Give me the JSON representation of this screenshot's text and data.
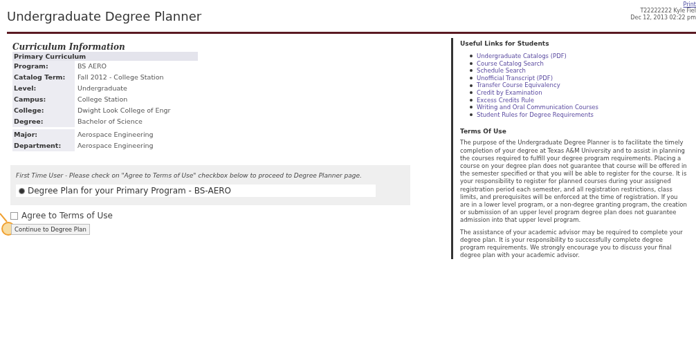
{
  "header": {
    "title": "Undergraduate Degree Planner",
    "print_link": "Print",
    "user": "T22222222 Kyle Fiel",
    "timestamp": "Dec 12, 2013 02:22 pm"
  },
  "curriculum": {
    "heading": "Curriculum Information",
    "subheading": "Primary Curriculum",
    "rows": [
      {
        "label": "Program:",
        "value": "BS AERO"
      },
      {
        "label": "Catalog Term:",
        "value": "Fall 2012 - College Station"
      },
      {
        "label": "Level:",
        "value": "Undergraduate"
      },
      {
        "label": "Campus:",
        "value": "College Station"
      },
      {
        "label": "College:",
        "value": "Dwight Look College of Engr"
      },
      {
        "label": "Degree:",
        "value": "Bachelor of Science"
      },
      {
        "label": "Major:",
        "value": "Aerospace Engineering"
      },
      {
        "label": "Department:",
        "value": "Aerospace Engineering"
      }
    ]
  },
  "notice": {
    "text": "First Time User - Please check on \"Agree to Terms of Use\" checkbox below to proceed to Degree Planner page.",
    "plan_option": {
      "label": "Degree Plan for your Primary Program - BS-AERO",
      "selected": true
    }
  },
  "agree": {
    "label": "Agree to Terms of Use",
    "checked": false
  },
  "continue_button": "Continue to Degree Plan",
  "links": {
    "heading": "Useful Links for Students",
    "items": [
      "Undergraduate Catalogs (PDF)",
      "Course Catalog Search",
      "Schedule Search",
      "Unofficial Transcript (PDF)",
      "Transfer Course Equivalency",
      "Credit by Examination",
      "Excess Credits Rule",
      "Writing and Oral Communication Courses",
      "Student Rules for Degree Requirements"
    ]
  },
  "terms": {
    "heading": "Terms Of Use",
    "paragraphs": [
      "The purpose of the Undergraduate Degree Planner is to facilitate the timely completion of your degree at Texas A&M University and to assist in planning the courses required to fulfill your degree program requirements. Placing a course on your degree plan does not guarantee that course will be offered in the semester specified or that you will be able to register for the course. It is your responsibility to register for planned courses during your assigned registration period each semester, and all registration restrictions, class limits, and prerequisites will be enforced at the time of registration. If you are in a lower level program, or a non-degree granting program, the creation or submission of an upper level program degree plan does not guarantee admission into that upper level program.",
      "The assistance of your academic advisor may be required to complete your degree plan. It is your responsibility to successfully complete degree program requirements. We strongly encourage you to discuss your final degree plan with your academic advisor."
    ]
  }
}
